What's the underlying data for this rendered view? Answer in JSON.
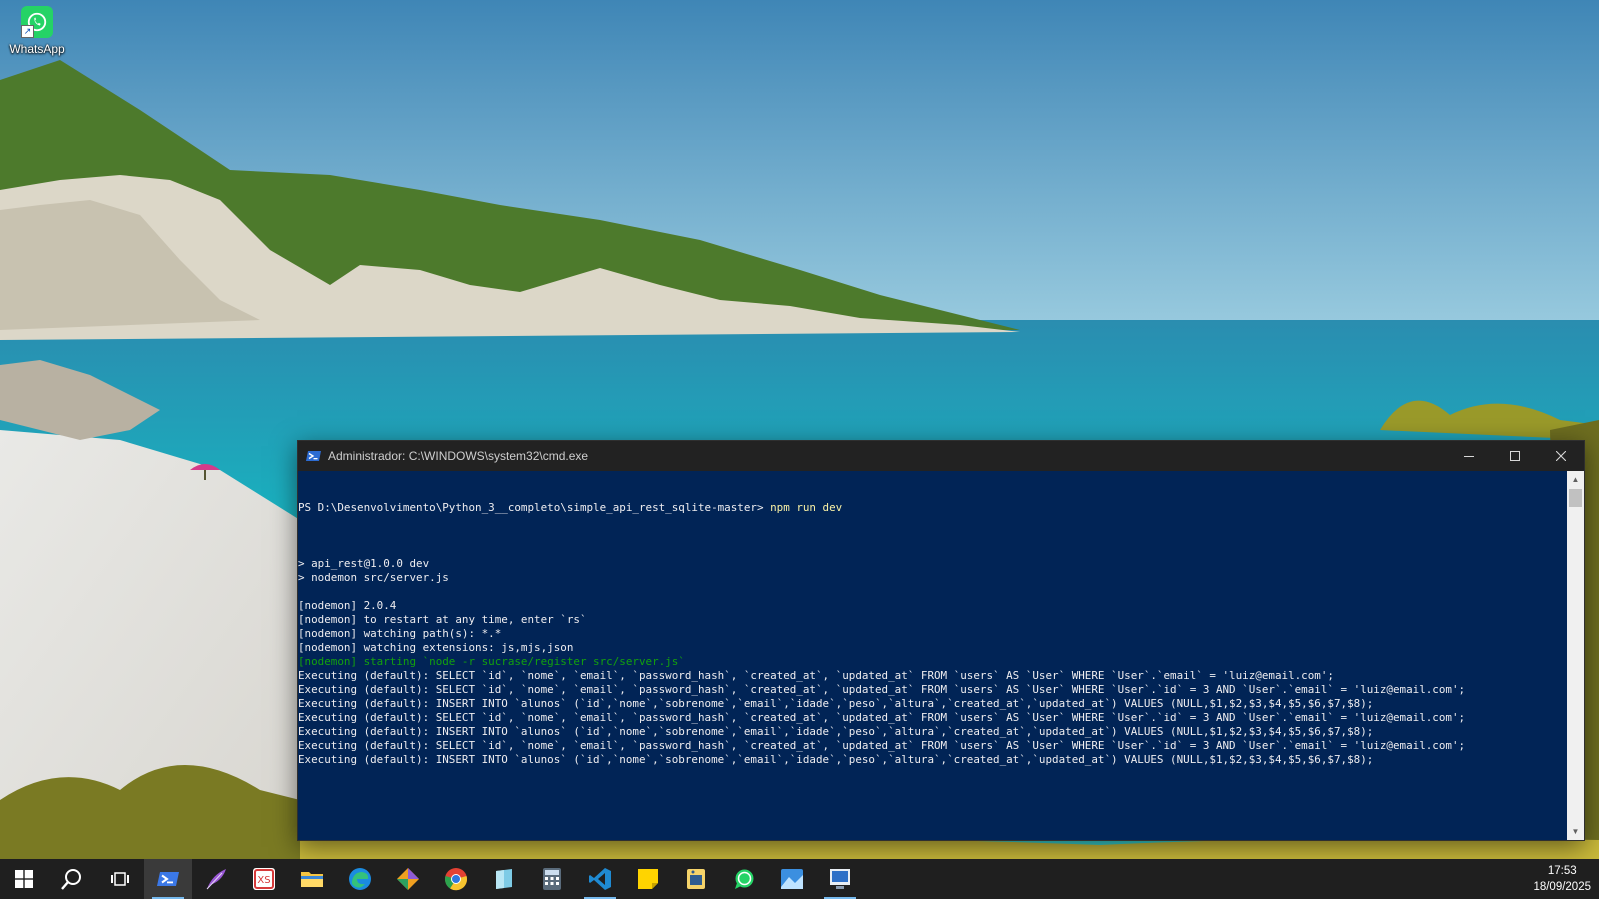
{
  "desktop": {
    "icons": [
      {
        "label": "WhatsApp",
        "icon": "whatsapp-icon"
      }
    ]
  },
  "terminal": {
    "title": "Administrador: C:\\WINDOWS\\system32\\cmd.exe",
    "prompt": "PS D:\\Desenvolvimento\\Python_3__completo\\simple_api_rest_sqlite-master> ",
    "command": "npm run dev",
    "lines": [
      {
        "text": "",
        "color": "default"
      },
      {
        "text": "> api_rest@1.0.0 dev",
        "color": "default"
      },
      {
        "text": "> nodemon src/server.js",
        "color": "default"
      },
      {
        "text": "",
        "color": "default"
      },
      {
        "text": "[nodemon] 2.0.4",
        "color": "default"
      },
      {
        "text": "[nodemon] to restart at any time, enter `rs`",
        "color": "default"
      },
      {
        "text": "[nodemon] watching path(s): *.*",
        "color": "default"
      },
      {
        "text": "[nodemon] watching extensions: js,mjs,json",
        "color": "default"
      },
      {
        "text": "[nodemon] starting `node -r sucrase/register src/server.js`",
        "color": "green"
      },
      {
        "text": "Executing (default): SELECT `id`, `nome`, `email`, `password_hash`, `created_at`, `updated_at` FROM `users` AS `User` WHERE `User`.`email` = 'luiz@email.com';",
        "color": "default"
      },
      {
        "text": "Executing (default): SELECT `id`, `nome`, `email`, `password_hash`, `created_at`, `updated_at` FROM `users` AS `User` WHERE `User`.`id` = 3 AND `User`.`email` = 'luiz@email.com';",
        "color": "default"
      },
      {
        "text": "Executing (default): INSERT INTO `alunos` (`id`,`nome`,`sobrenome`,`email`,`idade`,`peso`,`altura`,`created_at`,`updated_at`) VALUES (NULL,$1,$2,$3,$4,$5,$6,$7,$8);",
        "color": "default"
      },
      {
        "text": "Executing (default): SELECT `id`, `nome`, `email`, `password_hash`, `created_at`, `updated_at` FROM `users` AS `User` WHERE `User`.`id` = 3 AND `User`.`email` = 'luiz@email.com';",
        "color": "default"
      },
      {
        "text": "Executing (default): INSERT INTO `alunos` (`id`,`nome`,`sobrenome`,`email`,`idade`,`peso`,`altura`,`created_at`,`updated_at`) VALUES (NULL,$1,$2,$3,$4,$5,$6,$7,$8);",
        "color": "default"
      },
      {
        "text": "Executing (default): SELECT `id`, `nome`, `email`, `password_hash`, `created_at`, `updated_at` FROM `users` AS `User` WHERE `User`.`id` = 3 AND `User`.`email` = 'luiz@email.com';",
        "color": "default"
      },
      {
        "text": "Executing (default): INSERT INTO `alunos` (`id`,`nome`,`sobrenome`,`email`,`idade`,`peso`,`altura`,`created_at`,`updated_at`) VALUES (NULL,$1,$2,$3,$4,$5,$6,$7,$8);",
        "color": "default"
      }
    ],
    "colors": {
      "background": "#012456",
      "text": "#eeedf0",
      "command": "#f9f1a5",
      "nodemon_starting": "#13a10e"
    }
  },
  "taskbar": {
    "apps": [
      {
        "name": "start",
        "icon": "windows-start-icon"
      },
      {
        "name": "search",
        "icon": "search-icon"
      },
      {
        "name": "task-view",
        "icon": "task-view-icon"
      },
      {
        "name": "powershell",
        "icon": "powershell-icon",
        "state": "active"
      },
      {
        "name": "feather",
        "icon": "feather-icon"
      },
      {
        "name": "xs-app",
        "icon": "xs-app-icon"
      },
      {
        "name": "file-explorer",
        "icon": "folder-icon"
      },
      {
        "name": "edge",
        "icon": "edge-icon"
      },
      {
        "name": "git-kraken",
        "icon": "git-icon"
      },
      {
        "name": "chrome",
        "icon": "chrome-icon"
      },
      {
        "name": "notes",
        "icon": "notes-icon"
      },
      {
        "name": "calculator",
        "icon": "calculator-icon"
      },
      {
        "name": "vscode",
        "icon": "vscode-icon",
        "state": "running"
      },
      {
        "name": "sticky-notes",
        "icon": "sticky-notes-icon"
      },
      {
        "name": "python",
        "icon": "python-icon"
      },
      {
        "name": "whatsapp",
        "icon": "whatsapp-icon"
      },
      {
        "name": "photos",
        "icon": "photos-icon"
      },
      {
        "name": "remote-desktop",
        "icon": "remote-desktop-icon",
        "state": "running"
      }
    ],
    "clock": {
      "time": "17:53",
      "date": "18/09/2025"
    }
  }
}
